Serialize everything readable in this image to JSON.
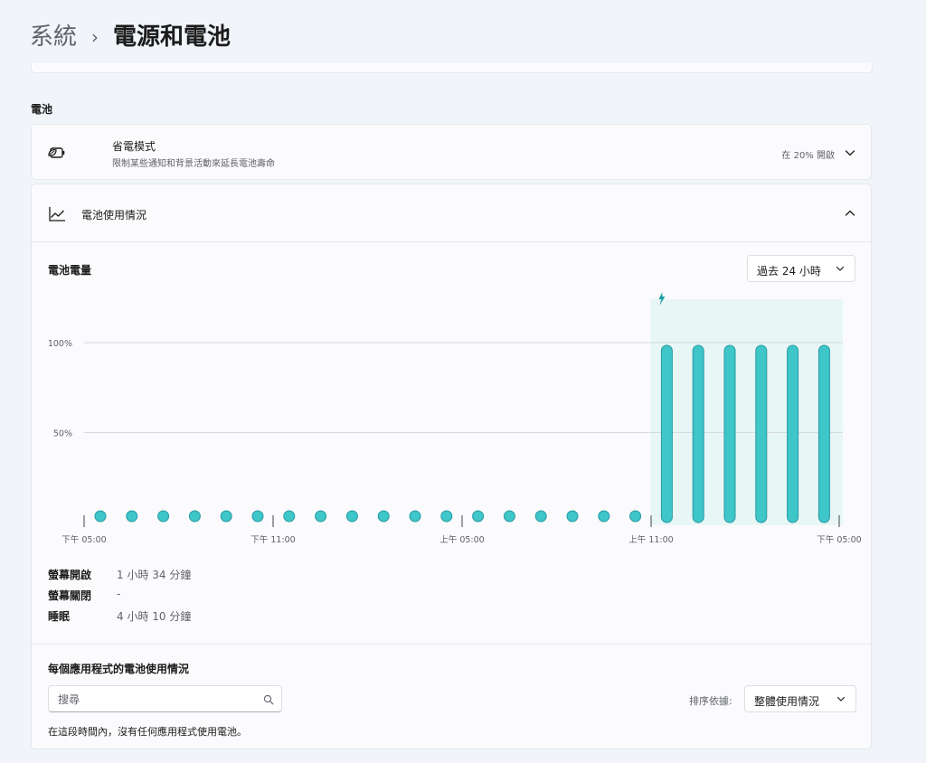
{
  "header": {
    "parent": "系統",
    "separator": "›",
    "current": "電源和電池"
  },
  "battery_section_label": "電池",
  "battery_saver": {
    "icon": "battery-leaf-icon",
    "title": "省電模式",
    "subtitle": "限制某些通知和背景活動來延長電池壽命",
    "status": "在 20% 開啟"
  },
  "battery_usage": {
    "icon": "line-chart-icon",
    "title": "電池使用情況",
    "level_title": "電池電量",
    "range_label": "過去 24 小時",
    "stats": [
      {
        "label": "螢幕開啟",
        "value": "1 小時 34 分鐘"
      },
      {
        "label": "螢幕關閉",
        "value": "-"
      },
      {
        "label": "睡眠",
        "value": "4 小時 10 分鐘"
      }
    ],
    "per_app_title": "每個應用程式的電池使用情況",
    "search_placeholder": "搜尋",
    "sort_label": "排序依據:",
    "sort_value": "整體使用情況",
    "empty_message": "在這段時間內，沒有任何應用程式使用電池。"
  },
  "colors": {
    "accent": "#3ec6c8",
    "bar_fill": "#3ec6c8",
    "bar_stroke": "#2a9aa3",
    "charging_band": "#e8f6f6",
    "charging_icon": "#1f9ea6"
  },
  "chart_data": {
    "type": "bar",
    "yticks": [
      "100%",
      "50%"
    ],
    "xticks": [
      "下午 05:00",
      "下午 11:00",
      "上午 05:00",
      "上午 11:00",
      "下午 05:00"
    ],
    "ylim": [
      0,
      100
    ],
    "charging_from_index": 18,
    "values": [
      0,
      0,
      0,
      0,
      0,
      0,
      0,
      0,
      0,
      0,
      0,
      0,
      0,
      0,
      0,
      0,
      0,
      0,
      100,
      100,
      100,
      100,
      100,
      100
    ]
  }
}
